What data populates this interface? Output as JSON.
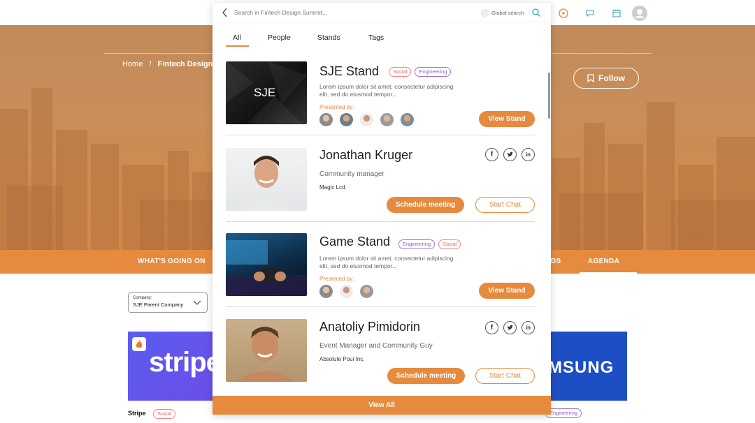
{
  "breadcrumb": {
    "home": "Home",
    "sep": "/",
    "current": "Fintech Design Summit"
  },
  "hero": {
    "follow_label": "Follow"
  },
  "nav": {
    "items": [
      "WHAT'S GOING ON",
      "DS",
      "AGENDA"
    ]
  },
  "company_select": {
    "label": "Company:",
    "value": "SJE Parent Company"
  },
  "partners": [
    {
      "name": "Stripe",
      "logo_text": "stripe",
      "tag": "Social"
    },
    {
      "logo_text": "MSUNG",
      "tag": "Engineering"
    }
  ],
  "search": {
    "placeholder": "Search in Fintech Design Summit...",
    "global_label": "Global search"
  },
  "tabs": [
    "All",
    "People",
    "Stands",
    "Tags"
  ],
  "results": [
    {
      "kind": "stand",
      "title": "SJE Stand",
      "image_text": "SJE",
      "tags": [
        "Social",
        "Engineering"
      ],
      "desc": "Lorem ipsum dolor sit amet, consectetur adipiscing elit, sed do eiusmod tempor...",
      "presented_by": "Presented by:",
      "button": "View Stand"
    },
    {
      "kind": "person",
      "title": "Jonathan Kruger",
      "role": "Community manager",
      "org": "Magic Lcd.",
      "primary": "Schedule meeting",
      "secondary": "Start Chat"
    },
    {
      "kind": "stand",
      "title": "Game Stand",
      "tags": [
        "Engineering",
        "Social"
      ],
      "desc": "Lorem ipsum dolor sit amet, consectetur adipiscing elit, sed do eiusmod tempor...",
      "presented_by": "Presented by:",
      "button": "View Stand"
    },
    {
      "kind": "person",
      "title": "Anatoliy Pimidorin",
      "role": "Event Manager and Community Guy",
      "org": "Absolute Poui Inc.",
      "primary": "Schedule meeting",
      "secondary": "Start Chat"
    }
  ],
  "view_all": "View All",
  "colors": {
    "accent": "#e68a3e",
    "eng": "#8b63c9",
    "social": "#e66666"
  },
  "icons": [
    "back-icon",
    "search-icon",
    "play-icon",
    "chat-icon",
    "calendar-icon",
    "avatar",
    "bookmark-icon",
    "facebook-icon",
    "twitter-icon",
    "linkedin-icon",
    "chevron-down-icon",
    "fire-icon"
  ]
}
